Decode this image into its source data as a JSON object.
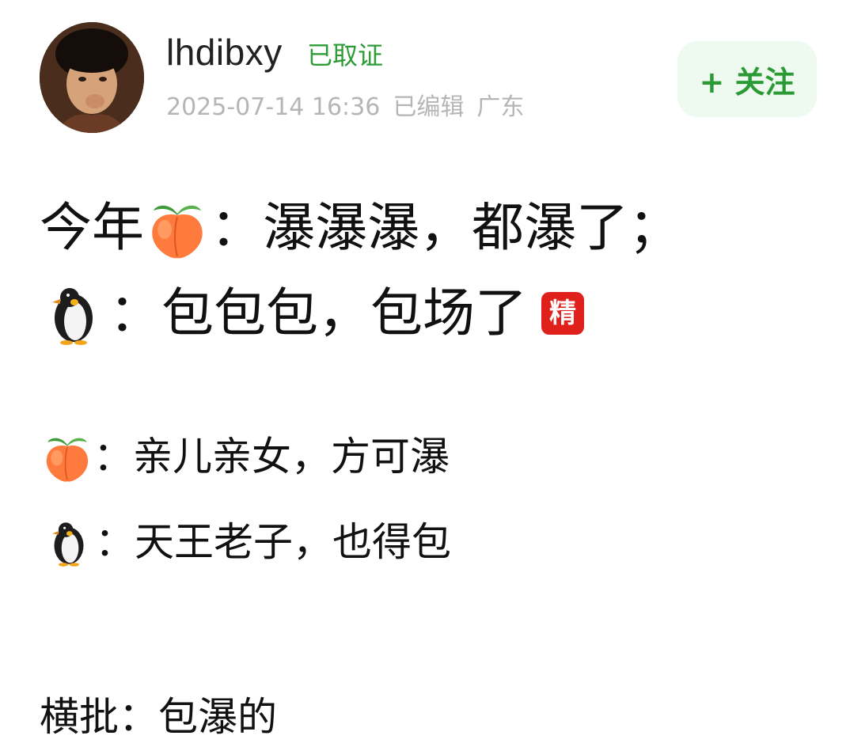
{
  "post": {
    "username": "lhdibxy",
    "verified_label": "已取证",
    "timestamp": "2025-07-14 16:36",
    "edited_label": "已编辑",
    "location": "广东",
    "follow_label": "+ 关注"
  },
  "content": {
    "line1_prefix": "今年",
    "line1_text": "：瀑瀑瀑，都瀑了；",
    "line2_text": "：包包包，包场了",
    "badge": "精",
    "line3_text": "：亲儿亲女，方可瀑",
    "line4_text": "：天王老子，也得包",
    "line5_text": "横批：包瀑的"
  },
  "icons": {
    "peach": "peach-emoji",
    "penguin": "penguin-emoji",
    "avatar": "avatar-photo"
  },
  "colors": {
    "verified": "#2e9b36",
    "follow_text": "#2a9a34",
    "follow_bg": "#eef9ef",
    "meta": "#b5b5b5",
    "badge_bg": "#e0201b"
  }
}
